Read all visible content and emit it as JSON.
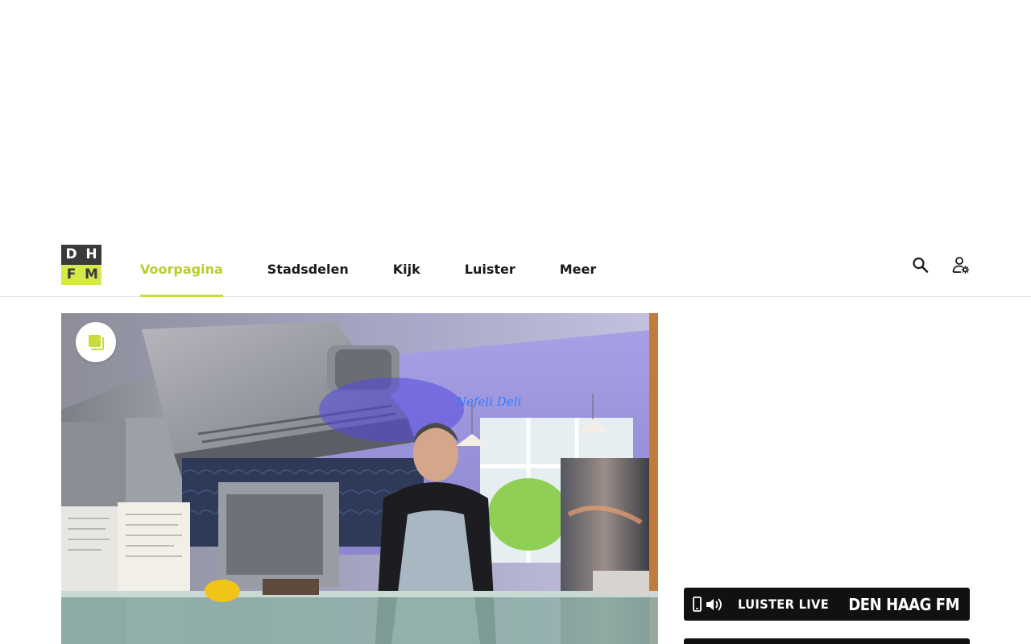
{
  "logo": {
    "letters": [
      "D",
      "H",
      "F",
      "M"
    ]
  },
  "nav": {
    "items": [
      {
        "label": "Voorpagina",
        "active": true
      },
      {
        "label": "Stadsdelen",
        "active": false
      },
      {
        "label": "Kijk",
        "active": false
      },
      {
        "label": "Luister",
        "active": false
      },
      {
        "label": "Meer",
        "active": false
      }
    ],
    "active_color": "#c9dc3a"
  },
  "header_icons": [
    "search-icon",
    "user-settings-icon"
  ],
  "hero": {
    "neon_sign": "Nefeli Deli",
    "badge_icon": "gallery-icon"
  },
  "listen_banner": {
    "label": "LUISTER LIVE",
    "station": "DEN HAAG",
    "station_suffix": "FM",
    "icons": [
      "phone-icon",
      "speaker-icon"
    ]
  },
  "colors": {
    "accent": "#c9dc3a",
    "logo_dark": "#3a3a3a",
    "banner_bg": "#111111"
  }
}
